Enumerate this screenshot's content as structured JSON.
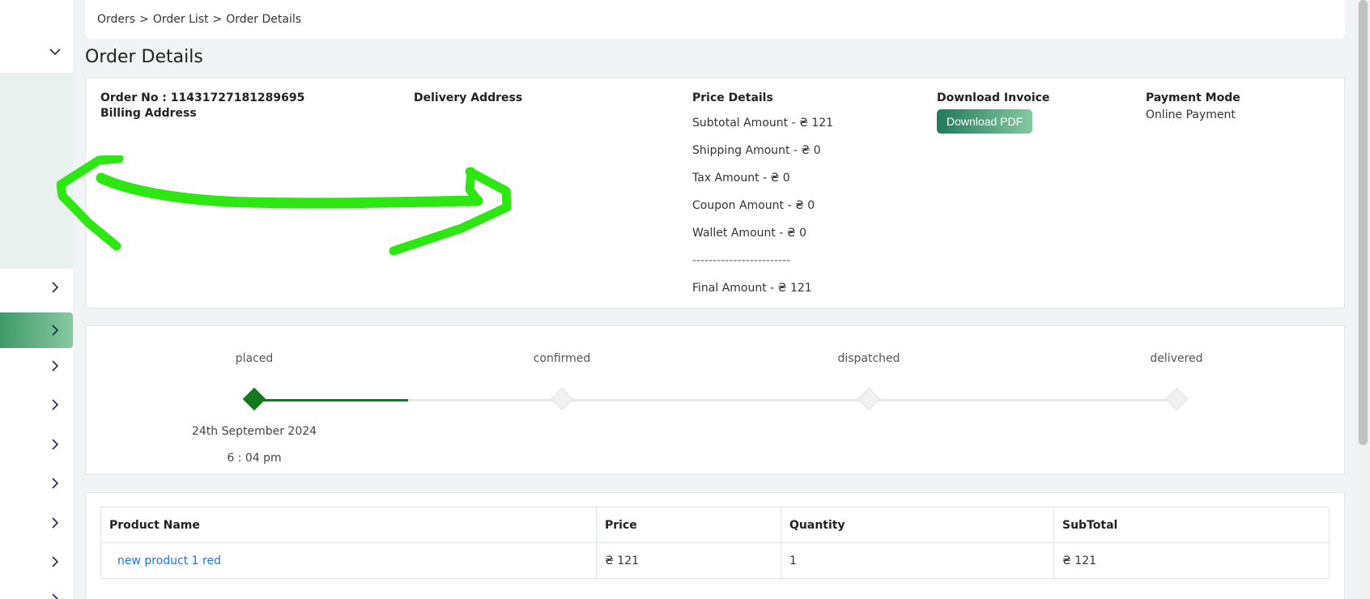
{
  "breadcrumb": {
    "items": [
      "Orders",
      "Order List",
      "Order Details"
    ],
    "separator": ">"
  },
  "page_title": "Order Details",
  "order": {
    "order_no_label": "Order No : 11431727181289695",
    "billing_label": "Billing Address",
    "delivery_label": "Delivery Address",
    "price_details": {
      "label": "Price Details",
      "subtotal": "Subtotal Amount - ₴ 121",
      "shipping": "Shipping Amount - ₴ 0",
      "tax": "Tax Amount - ₴ 0",
      "coupon": "Coupon Amount - ₴ 0",
      "wallet": "Wallet Amount - ₴ 0",
      "divider": "------------------------",
      "final": "Final Amount - ₴ 121"
    },
    "invoice": {
      "label": "Download Invoice",
      "button": "Download PDF"
    },
    "payment": {
      "label": "Payment Mode",
      "value": "Online Payment"
    }
  },
  "tracker": {
    "steps": [
      {
        "label": "placed",
        "done": true
      },
      {
        "label": "confirmed",
        "done": false
      },
      {
        "label": "dispatched",
        "done": false
      },
      {
        "label": "delivered",
        "done": false
      }
    ],
    "placed_date": "24th September 2024",
    "placed_time": "6 : 04 pm"
  },
  "table": {
    "headers": [
      "Product Name",
      "Price",
      "Quantity",
      "SubTotal"
    ],
    "rows": [
      {
        "product": "new product 1 red",
        "price": "₴ 121",
        "quantity": "1",
        "subtotal": "₴ 121"
      }
    ]
  },
  "colors": {
    "accent": "#127a1c",
    "button_start": "#1f7a5c",
    "button_end": "#86c9a0",
    "annotation": "#2de614",
    "link": "#1a73e8"
  }
}
